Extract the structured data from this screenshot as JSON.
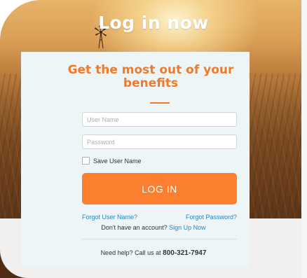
{
  "header": {
    "title": "Log in now"
  },
  "card": {
    "heading": "Get the most out of your benefits"
  },
  "form": {
    "username_placeholder": "User Name",
    "password_placeholder": "Password",
    "username_value": "",
    "password_value": "",
    "save_username_label": "Save User Name",
    "save_username_checked": false,
    "login_label": "LOG IN"
  },
  "links": {
    "forgot_username": "Forgot User Name?",
    "forgot_password": "Forgot Password?",
    "no_account_text": "Don't have an account?",
    "signup": "Sign Up Now"
  },
  "help": {
    "text": "Need help? Call us at",
    "phone": "800-321-7947"
  },
  "colors": {
    "accent": "#f07a2a",
    "button": "#fb7f2e",
    "link": "#2a84c1",
    "card_bg": "#eef5f7"
  },
  "icons": {
    "windmill": "windmill-icon"
  }
}
